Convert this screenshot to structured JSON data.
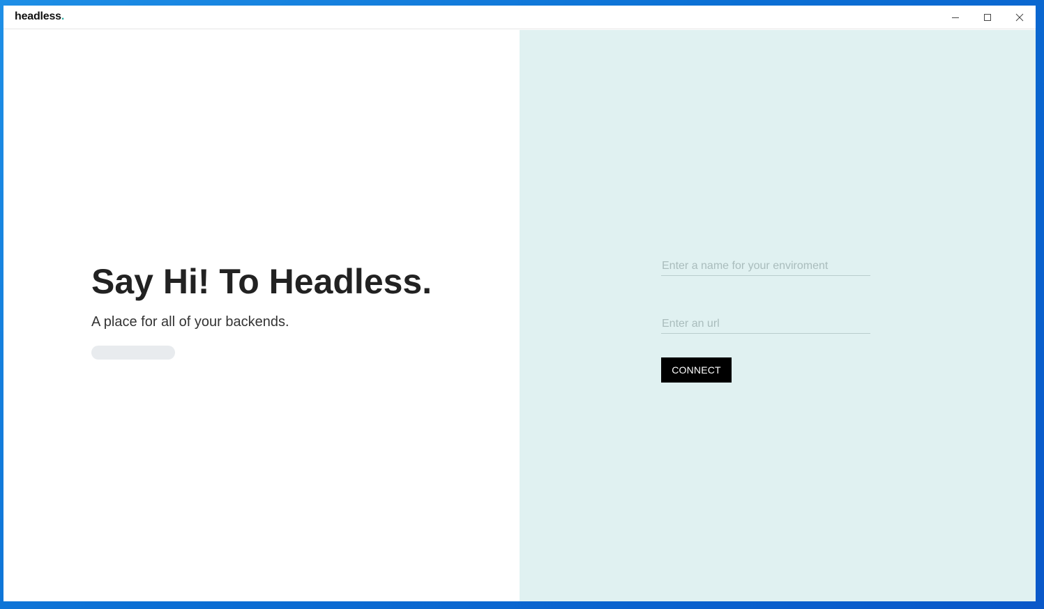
{
  "window": {
    "brand_name": "headless",
    "brand_dot": ".",
    "controls": {
      "minimize_icon": "minimize-icon",
      "maximize_icon": "maximize-icon",
      "close_icon": "close-icon"
    }
  },
  "hero": {
    "headline": "Say Hi! To Headless.",
    "tagline": "A place for all of your backends."
  },
  "form": {
    "name_placeholder": "Enter a name for your enviroment",
    "name_value": "",
    "url_placeholder": "Enter an url",
    "url_value": "",
    "connect_label": "CONNECT"
  },
  "colors": {
    "accent": "#2aa9a0",
    "right_pane_bg": "#e0f1f1",
    "button_bg": "#000000",
    "desktop_bg": "#0b6fd4"
  }
}
